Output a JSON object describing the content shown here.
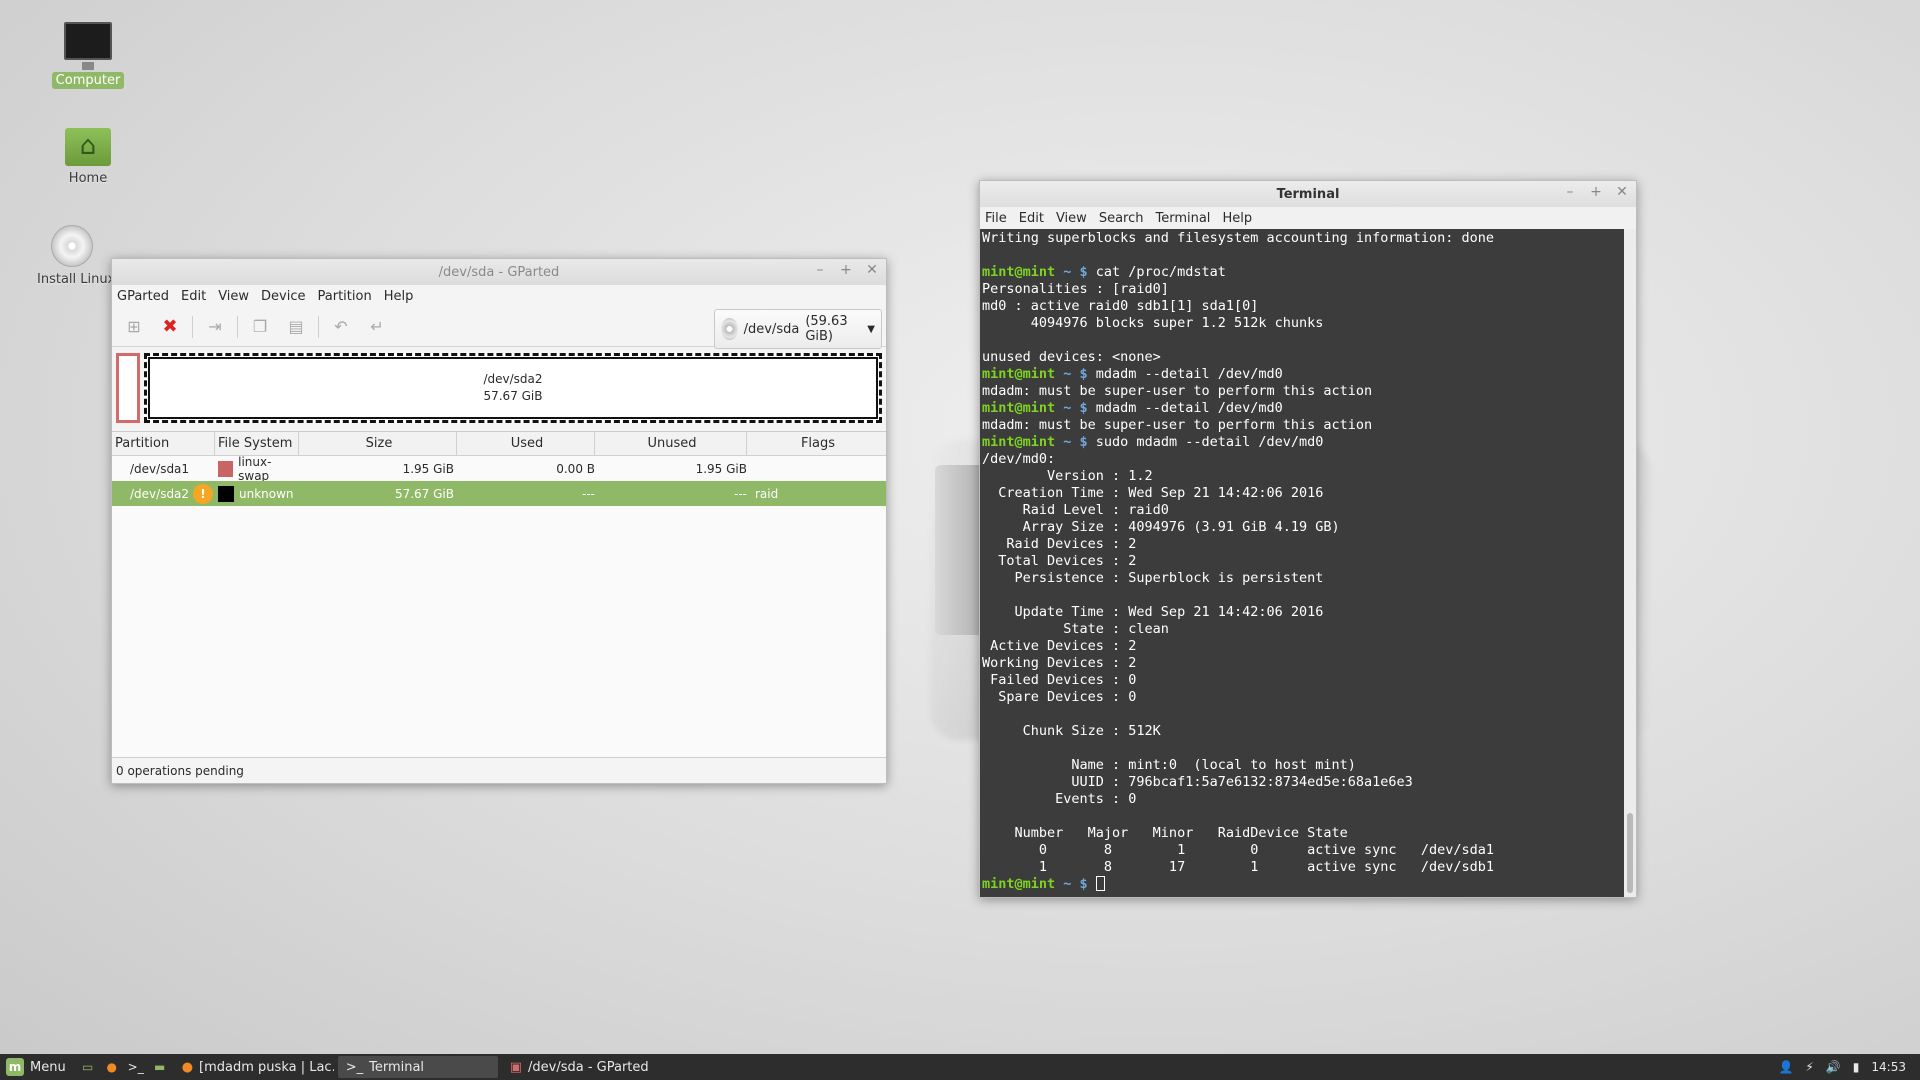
{
  "desktop": {
    "icons": [
      {
        "label": "Computer",
        "icon": "computer-icon"
      },
      {
        "label": "Home",
        "icon": "home-folder-icon"
      },
      {
        "label": "Install Linux Mint",
        "icon": "install-disc-icon"
      }
    ]
  },
  "gparted": {
    "title": "/dev/sda - GParted",
    "menu": [
      "GParted",
      "Edit",
      "View",
      "Device",
      "Partition",
      "Help"
    ],
    "device_selector": {
      "device": "/dev/sda",
      "size": "(59.63 GiB)"
    },
    "diskmap": {
      "name": "/dev/sda2",
      "size": "57.67 GiB"
    },
    "columns": [
      "Partition",
      "File System",
      "Size",
      "Used",
      "Unused",
      "Flags"
    ],
    "rows": [
      {
        "partition": "/dev/sda1",
        "fs": "linux-swap",
        "fs_color": "#c86464",
        "size": "1.95 GiB",
        "used": "0.00 B",
        "unused": "1.95 GiB",
        "flags": ""
      },
      {
        "partition": "/dev/sda2",
        "fs": "unknown",
        "fs_color": "#000000",
        "size": "57.67 GiB",
        "used": "---",
        "unused": "---",
        "flags": "raid"
      }
    ],
    "status": "0 operations pending"
  },
  "terminal": {
    "title": "Terminal",
    "menu": [
      "File",
      "Edit",
      "View",
      "Search",
      "Terminal",
      "Help"
    ],
    "prompt_user": "mint@mint",
    "prompt_dir": "~ $",
    "lines": [
      {
        "t": "out",
        "text": "Writing superblocks and filesystem accounting information: done"
      },
      {
        "t": "out",
        "text": ""
      },
      {
        "t": "cmd",
        "text": "cat /proc/mdstat"
      },
      {
        "t": "out",
        "text": "Personalities : [raid0]"
      },
      {
        "t": "out",
        "text": "md0 : active raid0 sdb1[1] sda1[0]"
      },
      {
        "t": "out",
        "text": "      4094976 blocks super 1.2 512k chunks"
      },
      {
        "t": "out",
        "text": ""
      },
      {
        "t": "out",
        "text": "unused devices: <none>"
      },
      {
        "t": "cmd",
        "text": "mdadm --detail /dev/md0"
      },
      {
        "t": "out",
        "text": "mdadm: must be super-user to perform this action"
      },
      {
        "t": "cmd",
        "text": "mdadm --detail /dev/md0"
      },
      {
        "t": "out",
        "text": "mdadm: must be super-user to perform this action"
      },
      {
        "t": "cmd",
        "text": "sudo mdadm --detail /dev/md0"
      },
      {
        "t": "out",
        "text": "/dev/md0:"
      },
      {
        "t": "out",
        "text": "        Version : 1.2"
      },
      {
        "t": "out",
        "text": "  Creation Time : Wed Sep 21 14:42:06 2016"
      },
      {
        "t": "out",
        "text": "     Raid Level : raid0"
      },
      {
        "t": "out",
        "text": "     Array Size : 4094976 (3.91 GiB 4.19 GB)"
      },
      {
        "t": "out",
        "text": "   Raid Devices : 2"
      },
      {
        "t": "out",
        "text": "  Total Devices : 2"
      },
      {
        "t": "out",
        "text": "    Persistence : Superblock is persistent"
      },
      {
        "t": "out",
        "text": ""
      },
      {
        "t": "out",
        "text": "    Update Time : Wed Sep 21 14:42:06 2016"
      },
      {
        "t": "out",
        "text": "          State : clean"
      },
      {
        "t": "out",
        "text": " Active Devices : 2"
      },
      {
        "t": "out",
        "text": "Working Devices : 2"
      },
      {
        "t": "out",
        "text": " Failed Devices : 0"
      },
      {
        "t": "out",
        "text": "  Spare Devices : 0"
      },
      {
        "t": "out",
        "text": ""
      },
      {
        "t": "out",
        "text": "     Chunk Size : 512K"
      },
      {
        "t": "out",
        "text": ""
      },
      {
        "t": "out",
        "text": "           Name : mint:0  (local to host mint)"
      },
      {
        "t": "out",
        "text": "           UUID : 796bcaf1:5a7e6132:8734ed5e:68a1e6e3"
      },
      {
        "t": "out",
        "text": "         Events : 0"
      },
      {
        "t": "out",
        "text": ""
      },
      {
        "t": "out",
        "text": "    Number   Major   Minor   RaidDevice State"
      },
      {
        "t": "out",
        "text": "       0       8        1        0      active sync   /dev/sda1"
      },
      {
        "t": "out",
        "text": "       1       8       17        1      active sync   /dev/sdb1"
      },
      {
        "t": "cmd",
        "text": ""
      }
    ]
  },
  "taskbar": {
    "menu_label": "Menu",
    "tasks": [
      {
        "label": "[mdadm puska | Lac...",
        "icon": "firefox-icon",
        "active": false
      },
      {
        "label": "Terminal",
        "icon": "terminal-icon",
        "active": true
      },
      {
        "label": "/dev/sda - GParted",
        "icon": "gparted-icon",
        "active": false
      }
    ],
    "clock": "14:53"
  },
  "colors": {
    "accent": "#8fb967",
    "terminal_bg": "#3c3c3c",
    "prompt_green": "#7ed321",
    "prompt_blue": "#6fa8dc"
  }
}
